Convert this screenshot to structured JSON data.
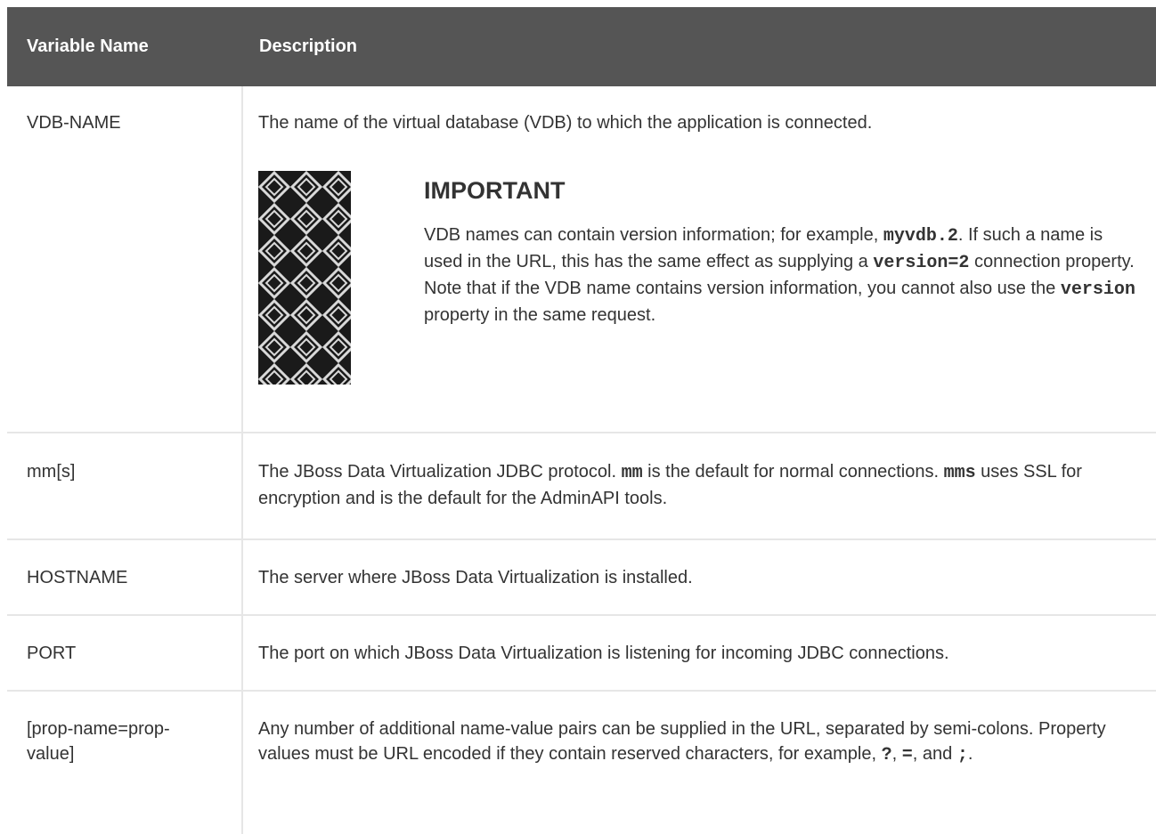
{
  "header": {
    "col_name": "Variable Name",
    "col_desc": "Description"
  },
  "rows": [
    {
      "name": "VDB-NAME",
      "desc": "The name of the virtual database (VDB) to which the application is connected.",
      "admonition": {
        "title": "IMPORTANT",
        "t1": "VDB names can contain version information; for example, ",
        "c1": "myvdb.2",
        "t2": ". If such a name is used in the URL, this has the same effect as supplying a ",
        "c2": "version=2",
        "t3": " connection property. Note that if the VDB name contains version information, you cannot also use the ",
        "c3": "version",
        "t4": " property in the same request."
      }
    },
    {
      "name": "mm[s]",
      "t1": "The JBoss Data Virtualization JDBC protocol. ",
      "c1": "mm",
      "t2": " is the default for normal connections. ",
      "c2": "mms",
      "t3": " uses SSL for encryption and is the default for the AdminAPI tools."
    },
    {
      "name": "HOSTNAME",
      "desc": "The server where JBoss Data Virtualization is installed."
    },
    {
      "name": "PORT",
      "desc": "The port on which JBoss Data Virtualization is listening for incoming JDBC connections."
    },
    {
      "name": "[prop-name=prop-value]",
      "t1": "Any number of additional name-value pairs can be supplied in the URL, separated by semi-colons. Property values must be URL encoded if they contain reserved characters, for example, ",
      "c1": "?",
      "t2": ", ",
      "c2": "=",
      "t3": ", and ",
      "c3": ";",
      "t4": "."
    }
  ],
  "colors": {
    "header_bg": "#555555",
    "border": "#e6e6e6",
    "text": "#333333"
  },
  "icons": {
    "admonition": "important-pattern-icon"
  }
}
